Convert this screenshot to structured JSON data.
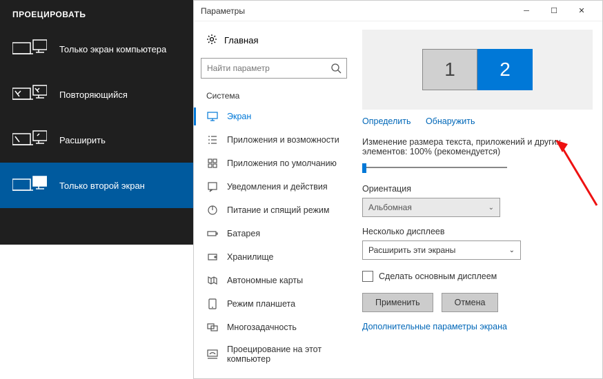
{
  "project": {
    "title": "ПРОЕЦИРОВАТЬ",
    "items": [
      {
        "label": "Только экран компьютера"
      },
      {
        "label": "Повторяющийся"
      },
      {
        "label": "Расширить"
      },
      {
        "label": "Только второй экран"
      }
    ],
    "selected_index": 3
  },
  "settings": {
    "window_title": "Параметры",
    "home": "Главная",
    "search_placeholder": "Найти параметр",
    "group": "Система",
    "nav": [
      {
        "label": "Экран"
      },
      {
        "label": "Приложения и возможности"
      },
      {
        "label": "Приложения по умолчанию"
      },
      {
        "label": "Уведомления и действия"
      },
      {
        "label": "Питание и спящий режим"
      },
      {
        "label": "Батарея"
      },
      {
        "label": "Хранилище"
      },
      {
        "label": "Автономные карты"
      },
      {
        "label": "Режим планшета"
      },
      {
        "label": "Многозадачность"
      },
      {
        "label": "Проецирование на этот компьютер"
      }
    ],
    "nav_selected_index": 0
  },
  "display": {
    "monitor1": "1",
    "monitor2": "2",
    "identify": "Определить",
    "detect": "Обнаружить",
    "scale_label": "Изменение размера текста, приложений и других элементов: 100% (рекомендуется)",
    "orientation_label": "Ориентация",
    "orientation_value": "Альбомная",
    "multi_label": "Несколько дисплеев",
    "multi_value": "Расширить эти экраны",
    "make_main": "Сделать основным дисплеем",
    "apply": "Применить",
    "cancel": "Отмена",
    "advanced": "Дополнительные параметры экрана"
  }
}
